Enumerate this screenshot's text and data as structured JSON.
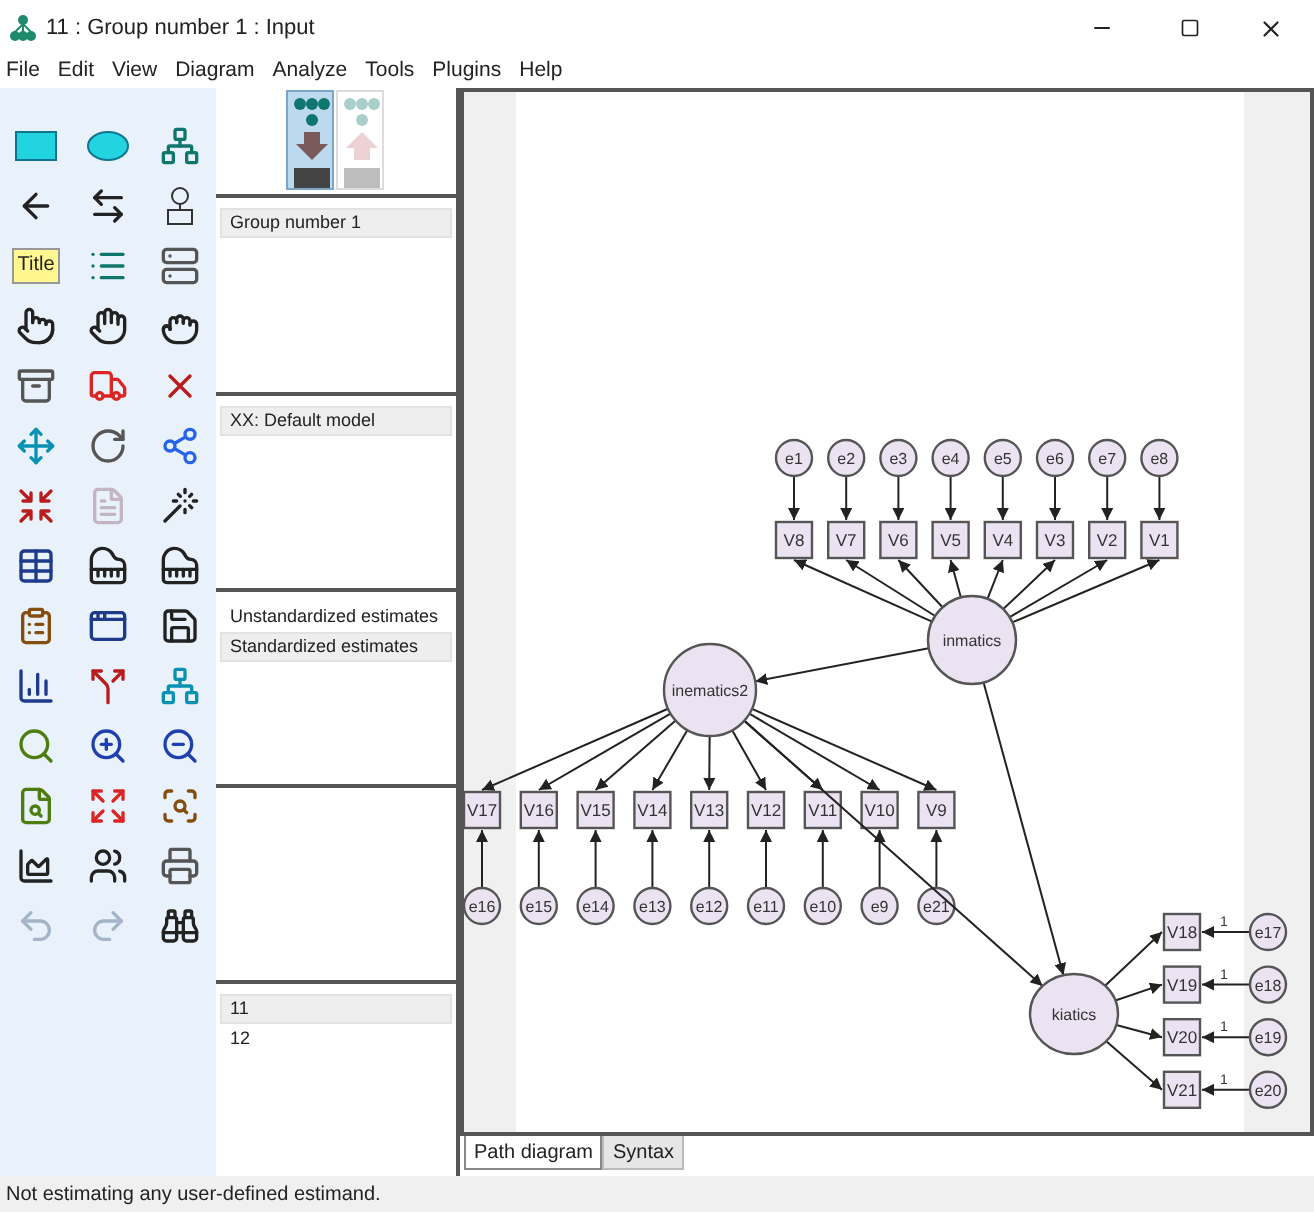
{
  "window": {
    "title": "11 : Group number 1 : Input"
  },
  "menu": [
    "File",
    "Edit",
    "View",
    "Diagram",
    "Analyze",
    "Tools",
    "Plugins",
    "Help"
  ],
  "toolbar": {
    "title_tool": "Title"
  },
  "view_toggle": [
    {
      "selected": true
    },
    {
      "selected": false
    }
  ],
  "groups": [
    {
      "label": "Group number 1",
      "selected": true
    }
  ],
  "models": [
    {
      "label": "XX: Default model",
      "selected": true
    }
  ],
  "estimate_types": [
    {
      "label": "Unstandardized estimates",
      "selected": false
    },
    {
      "label": "Standardized estimates",
      "selected": true
    }
  ],
  "file_list": [
    {
      "label": "11",
      "selected": true
    },
    {
      "label": "12",
      "selected": false
    }
  ],
  "diagram": {
    "factors": [
      {
        "name": "inmatics",
        "indicators": [
          {
            "name": "V8",
            "error": "e1"
          },
          {
            "name": "V7",
            "error": "e2"
          },
          {
            "name": "V6",
            "error": "e3"
          },
          {
            "name": "V5",
            "error": "e4"
          },
          {
            "name": "V4",
            "error": "e5"
          },
          {
            "name": "V3",
            "error": "e6"
          },
          {
            "name": "V2",
            "error": "e7"
          },
          {
            "name": "V1",
            "error": "e8"
          }
        ]
      },
      {
        "name": "inematics2",
        "indicators": [
          {
            "name": "V17",
            "error": "e16"
          },
          {
            "name": "V16",
            "error": "e15"
          },
          {
            "name": "V15",
            "error": "e14"
          },
          {
            "name": "V14",
            "error": "e13"
          },
          {
            "name": "V13",
            "error": "e12"
          },
          {
            "name": "V12",
            "error": "e11"
          },
          {
            "name": "V11",
            "error": "e10"
          },
          {
            "name": "V10",
            "error": "e9"
          },
          {
            "name": "V9",
            "error": "e21"
          }
        ]
      },
      {
        "name": "kiatics",
        "indicators": [
          {
            "name": "V18",
            "error": "e17",
            "weight": "1"
          },
          {
            "name": "V19",
            "error": "e18",
            "weight": "1"
          },
          {
            "name": "V20",
            "error": "e19",
            "weight": "1"
          },
          {
            "name": "V21",
            "error": "e20",
            "weight": "1"
          }
        ]
      }
    ]
  },
  "canvas_tabs": [
    {
      "label": "Path diagram",
      "selected": true
    },
    {
      "label": "Syntax",
      "selected": false
    }
  ],
  "status_bar": "Not estimating any user-defined estimand."
}
